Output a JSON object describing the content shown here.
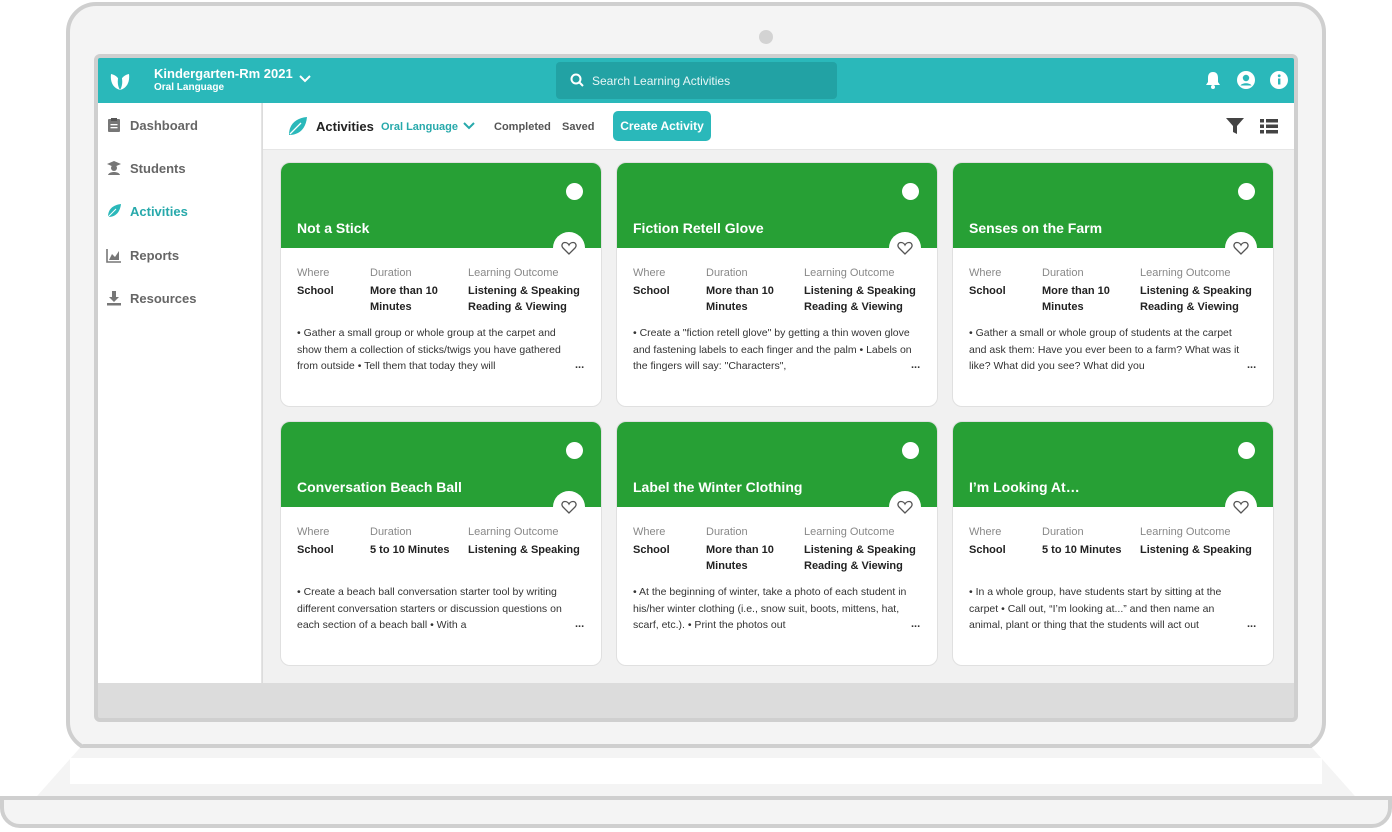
{
  "header": {
    "class_name": "Kindergarten-Rm 2021",
    "class_sub": "Oral Language",
    "search_placeholder": "Search Learning Activities"
  },
  "sidebar": {
    "items": [
      {
        "label": "Dashboard",
        "icon": "clipboard-icon",
        "active": false
      },
      {
        "label": "Students",
        "icon": "student-icon",
        "active": false
      },
      {
        "label": "Activities",
        "icon": "leaf-icon",
        "active": true
      },
      {
        "label": "Reports",
        "icon": "chart-icon",
        "active": false
      },
      {
        "label": "Resources",
        "icon": "download-icon",
        "active": false
      }
    ]
  },
  "subbar": {
    "title": "Activities",
    "filter": "Oral Language",
    "completed": "Completed",
    "saved": "Saved",
    "create": "Create Activity"
  },
  "labels": {
    "where": "Where",
    "duration": "Duration",
    "outcome": "Learning Outcome",
    "more": "..."
  },
  "cards": [
    {
      "title": "Not a Stick",
      "where": "School",
      "duration": "More than 10 Minutes",
      "outcome": "Listening & Speaking Reading & Viewing",
      "desc": "• Gather a small group or whole group at the carpet and show them a collection of sticks/twigs you have gathered from outside • Tell them that today they will"
    },
    {
      "title": "Fiction Retell Glove",
      "where": "School",
      "duration": "More than 10 Minutes",
      "outcome": "Listening & Speaking Reading & Viewing",
      "desc": "• Create a \"fiction retell glove\" by getting a thin woven glove and fastening labels to each finger and the palm • Labels on the fingers will say: \"Characters\","
    },
    {
      "title": "Senses on the Farm",
      "where": "School",
      "duration": "More than 10 Minutes",
      "outcome": "Listening & Speaking Reading & Viewing",
      "desc": "• Gather a small or whole group of students at the carpet and ask them: Have you ever been to a farm? What was it like? What did you see? What did you"
    },
    {
      "title": "Conversation Beach Ball",
      "where": "School",
      "duration": "5 to 10 Minutes",
      "outcome": "Listening & Speaking",
      "desc": "• Create a beach ball conversation starter tool by writing different conversation starters or discussion questions on each section of a beach ball • With a"
    },
    {
      "title": "Label the Winter Clothing",
      "where": "School",
      "duration": "More than 10 Minutes",
      "outcome": "Listening & Speaking Reading & Viewing",
      "desc": "• At the beginning of winter, take a photo of each student in his/her winter clothing (i.e., snow suit, boots, mittens, hat, scarf, etc.). • Print the photos out"
    },
    {
      "title": "I’m Looking At…",
      "where": "School",
      "duration": "5 to 10 Minutes",
      "outcome": "Listening & Speaking",
      "desc": "• In a whole group, have students start by sitting at the carpet • Call out, “I’m looking at...” and then name an animal, plant or thing that the students will act out"
    }
  ],
  "colors": {
    "teal": "#2ab8ba",
    "green": "#27a035"
  }
}
